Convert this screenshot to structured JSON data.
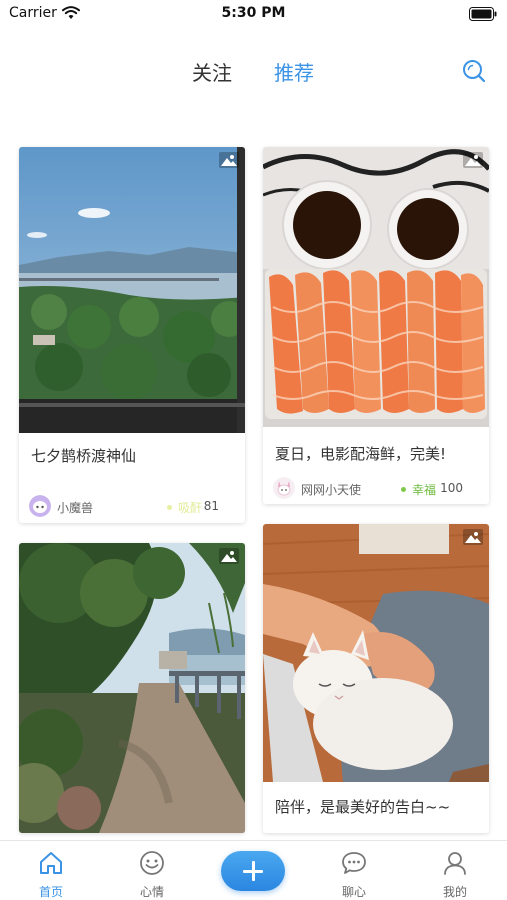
{
  "status_bar": {
    "carrier": "Carrier",
    "time": "5:30 PM"
  },
  "top_nav": {
    "tabs": [
      {
        "label": "关注",
        "active": false
      },
      {
        "label": "推荐",
        "active": true
      }
    ]
  },
  "feed": {
    "cards": [
      {
        "title": "七夕鹊桥渡神仙",
        "author": "小魔兽",
        "mood": "吸酐",
        "mood_color": "#e6f0a0",
        "count": "81"
      },
      {
        "title": "夏日，电影配海鲜，完美!",
        "author": "网网小天使",
        "mood": "幸福",
        "mood_color": "#7ec84a",
        "count": "100"
      },
      {
        "title": "",
        "author": "",
        "mood": "",
        "count": ""
      },
      {
        "title": "陪伴，是最美好的告白~~",
        "author": "",
        "mood": "",
        "count": ""
      }
    ]
  },
  "tab_bar": {
    "items": [
      {
        "label": "首页",
        "icon": "home-icon",
        "active": true
      },
      {
        "label": "心情",
        "icon": "smiley-icon",
        "active": false
      },
      {
        "label": "聊心",
        "icon": "chat-bubble-icon",
        "active": false
      },
      {
        "label": "我的",
        "icon": "person-icon",
        "active": false
      }
    ],
    "compose_icon": "plus-icon"
  },
  "colors": {
    "accent": "#3b93e6",
    "text": "#333333"
  }
}
